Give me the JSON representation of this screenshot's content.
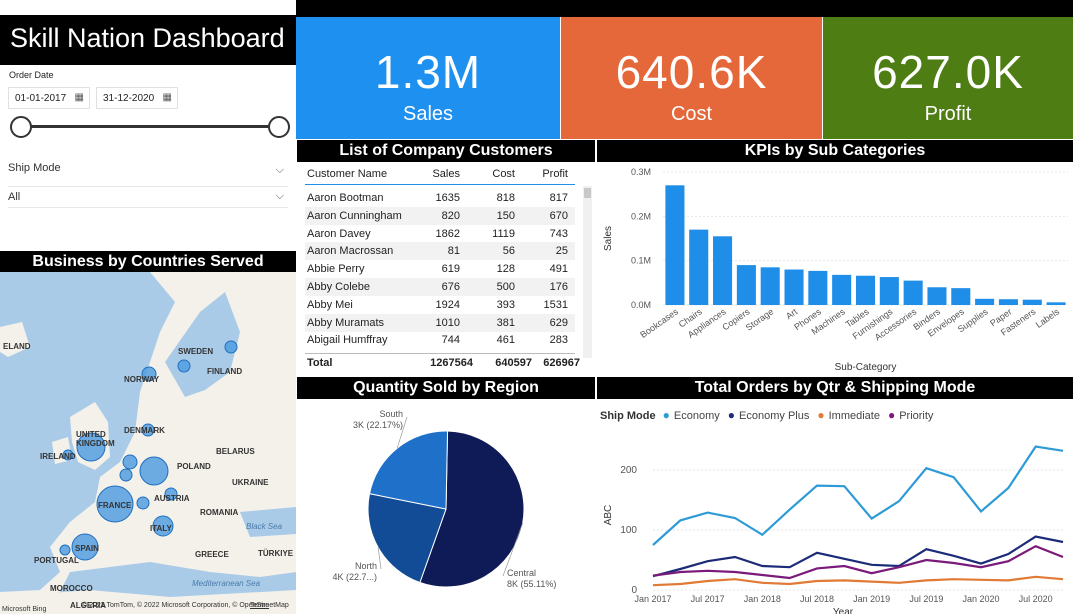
{
  "dashboard": {
    "title": "Skill Nation Dashboard"
  },
  "filters": {
    "order_date_label": "Order Date",
    "date_from": "01-01-2017",
    "date_to": "31-12-2020",
    "ship_mode_label": "Ship Mode",
    "ship_mode_value": "All"
  },
  "kpis": [
    {
      "value": "1.3M",
      "label": "Sales",
      "color": "#1e90f0"
    },
    {
      "value": "640.6K",
      "label": "Cost",
      "color": "#e5683a"
    },
    {
      "value": "627.0K",
      "label": "Profit",
      "color": "#4e7d14"
    }
  ],
  "headers": {
    "countries": "Business by Countries Served",
    "customers": "List of Company Customers",
    "kpis_sub": "KPIs by Sub Categories",
    "quantity": "Quantity Sold by Region",
    "orders": "Total Orders by Qtr & Shipping Mode"
  },
  "map": {
    "labels": [
      "ELAND",
      "SWEDEN",
      "NORWAY",
      "FINLAND",
      "UNITED KINGDOM",
      "DENMARK",
      "IRELAND",
      "BELARUS",
      "POLAND",
      "UKRAINE",
      "FRANCE",
      "AUSTRIA",
      "ROMANIA",
      "Black Sea",
      "ITALY",
      "SPAIN",
      "PORTUGAL",
      "GREECE",
      "TÜRKIYE",
      "MOROCCO",
      "Mediterranean Sea",
      "ALGERIA"
    ],
    "attribution": "© 2022 TomTom, © 2022 Microsoft Corporation, © OpenStreetMap",
    "terms": "Terms",
    "brand": "Microsoft Bing"
  },
  "customers": {
    "columns": [
      "Customer Name",
      "Sales",
      "Cost",
      "Profit"
    ],
    "rows": [
      [
        "Aaron Bootman",
        "1635",
        "818",
        "817"
      ],
      [
        "Aaron Cunningham",
        "820",
        "150",
        "670"
      ],
      [
        "Aaron Davey",
        "1862",
        "1119",
        "743"
      ],
      [
        "Aaron Macrossan",
        "81",
        "56",
        "25"
      ],
      [
        "Abbie Perry",
        "619",
        "128",
        "491"
      ],
      [
        "Abby Colebe",
        "676",
        "500",
        "176"
      ],
      [
        "Abby Mei",
        "1924",
        "393",
        "1531"
      ],
      [
        "Abby Muramats",
        "1010",
        "381",
        "629"
      ],
      [
        "Abigail Humffray",
        "744",
        "461",
        "283"
      ]
    ],
    "total": [
      "Total",
      "1267564",
      "640597",
      "626967"
    ]
  },
  "chart_data": [
    {
      "type": "bar",
      "xlabel": "Sub-Category",
      "ylabel": "Sales",
      "ylim": [
        0,
        0.3
      ],
      "yticks": [
        "0.0M",
        "0.1M",
        "0.2M",
        "0.3M"
      ],
      "categories": [
        "Bookcases",
        "Chairs",
        "Appliances",
        "Copiers",
        "Storage",
        "Art",
        "Phones",
        "Machines",
        "Tables",
        "Furnishings",
        "Accessories",
        "Binders",
        "Envelopes",
        "Supplies",
        "Paper",
        "Fasteners",
        "Labels"
      ],
      "values": [
        0.27,
        0.17,
        0.155,
        0.09,
        0.085,
        0.08,
        0.077,
        0.068,
        0.066,
        0.063,
        0.055,
        0.04,
        0.038,
        0.014,
        0.013,
        0.012,
        0.006
      ],
      "color": "#1e8ee8"
    },
    {
      "type": "pie",
      "slices": [
        {
          "name": "Central",
          "label": "8K (55.11%)",
          "value": 55.11,
          "color": "#0f1b57"
        },
        {
          "name": "North",
          "label": "4K (22.7...)",
          "value": 22.72,
          "color": "#134c96"
        },
        {
          "name": "South",
          "label": "3K (22.17%)",
          "value": 22.17,
          "color": "#1e70c8"
        }
      ]
    },
    {
      "type": "line",
      "legend_title": "Ship Mode",
      "ylabel": "ABC",
      "xlabel": "Year",
      "ylim": [
        0,
        250
      ],
      "yticks": [
        0,
        100,
        200
      ],
      "xticks": [
        "Jan 2017",
        "Jul 2017",
        "Jan 2018",
        "Jul 2018",
        "Jan 2019",
        "Jul 2019",
        "Jan 2020",
        "Jul 2020"
      ],
      "series": [
        {
          "name": "Economy",
          "color": "#2e9bd6",
          "values": [
            75,
            116,
            129,
            120,
            92,
            134,
            174,
            173,
            119,
            148,
            203,
            188,
            131,
            170,
            239,
            232
          ]
        },
        {
          "name": "Economy Plus",
          "color": "#1c2b78",
          "values": [
            23,
            35,
            48,
            55,
            40,
            38,
            62,
            52,
            42,
            40,
            68,
            57,
            44,
            60,
            89,
            80
          ]
        },
        {
          "name": "Immediate",
          "color": "#e07a35",
          "values": [
            8,
            10,
            15,
            18,
            12,
            10,
            15,
            16,
            14,
            12,
            16,
            18,
            17,
            16,
            22,
            18
          ]
        },
        {
          "name": "Priority",
          "color": "#7a1a7a",
          "values": [
            24,
            30,
            32,
            30,
            25,
            20,
            36,
            40,
            28,
            38,
            50,
            45,
            38,
            48,
            73,
            55
          ]
        }
      ]
    }
  ]
}
